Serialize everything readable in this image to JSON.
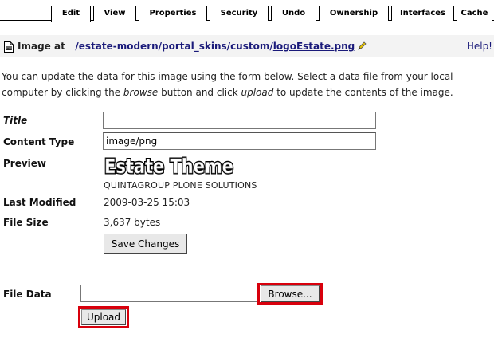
{
  "tabs": [
    {
      "label": "Edit",
      "active": true
    },
    {
      "label": "View",
      "active": false
    },
    {
      "label": "Properties",
      "active": false
    },
    {
      "label": "Security",
      "active": false
    },
    {
      "label": "Undo",
      "active": false
    },
    {
      "label": "Ownership",
      "active": false
    },
    {
      "label": "Interfaces",
      "active": false
    },
    {
      "label": "Cache",
      "active": false
    }
  ],
  "header": {
    "prefix": "Image at",
    "path": [
      "/estate-modern",
      "portal_skins",
      "custom",
      "logoEstate.png"
    ],
    "help": "Help!"
  },
  "intro": {
    "part1": "You can update the data for this image using the form below. Select a data file from your local computer by clicking the ",
    "browse_word": "browse",
    "part2": " button and click ",
    "upload_word": "upload",
    "part3": " to update the contents of the image."
  },
  "form": {
    "title_label": "Title",
    "title_value": "",
    "content_type_label": "Content Type",
    "content_type_value": "image/png",
    "preview_label": "Preview",
    "preview_logo_text": "Estate Theme",
    "preview_caption": "QUINTAGROUP PLONE SOLUTIONS",
    "last_modified_label": "Last Modified",
    "last_modified_value": "2009-03-25 15:03",
    "file_size_label": "File Size",
    "file_size_value": "3,637 bytes",
    "save_label": "Save Changes"
  },
  "upload": {
    "file_data_label": "File Data",
    "browse_label": "Browse...",
    "upload_label": "Upload"
  },
  "colors": {
    "highlight": "#d8000c",
    "link": "#1a1a7a"
  }
}
